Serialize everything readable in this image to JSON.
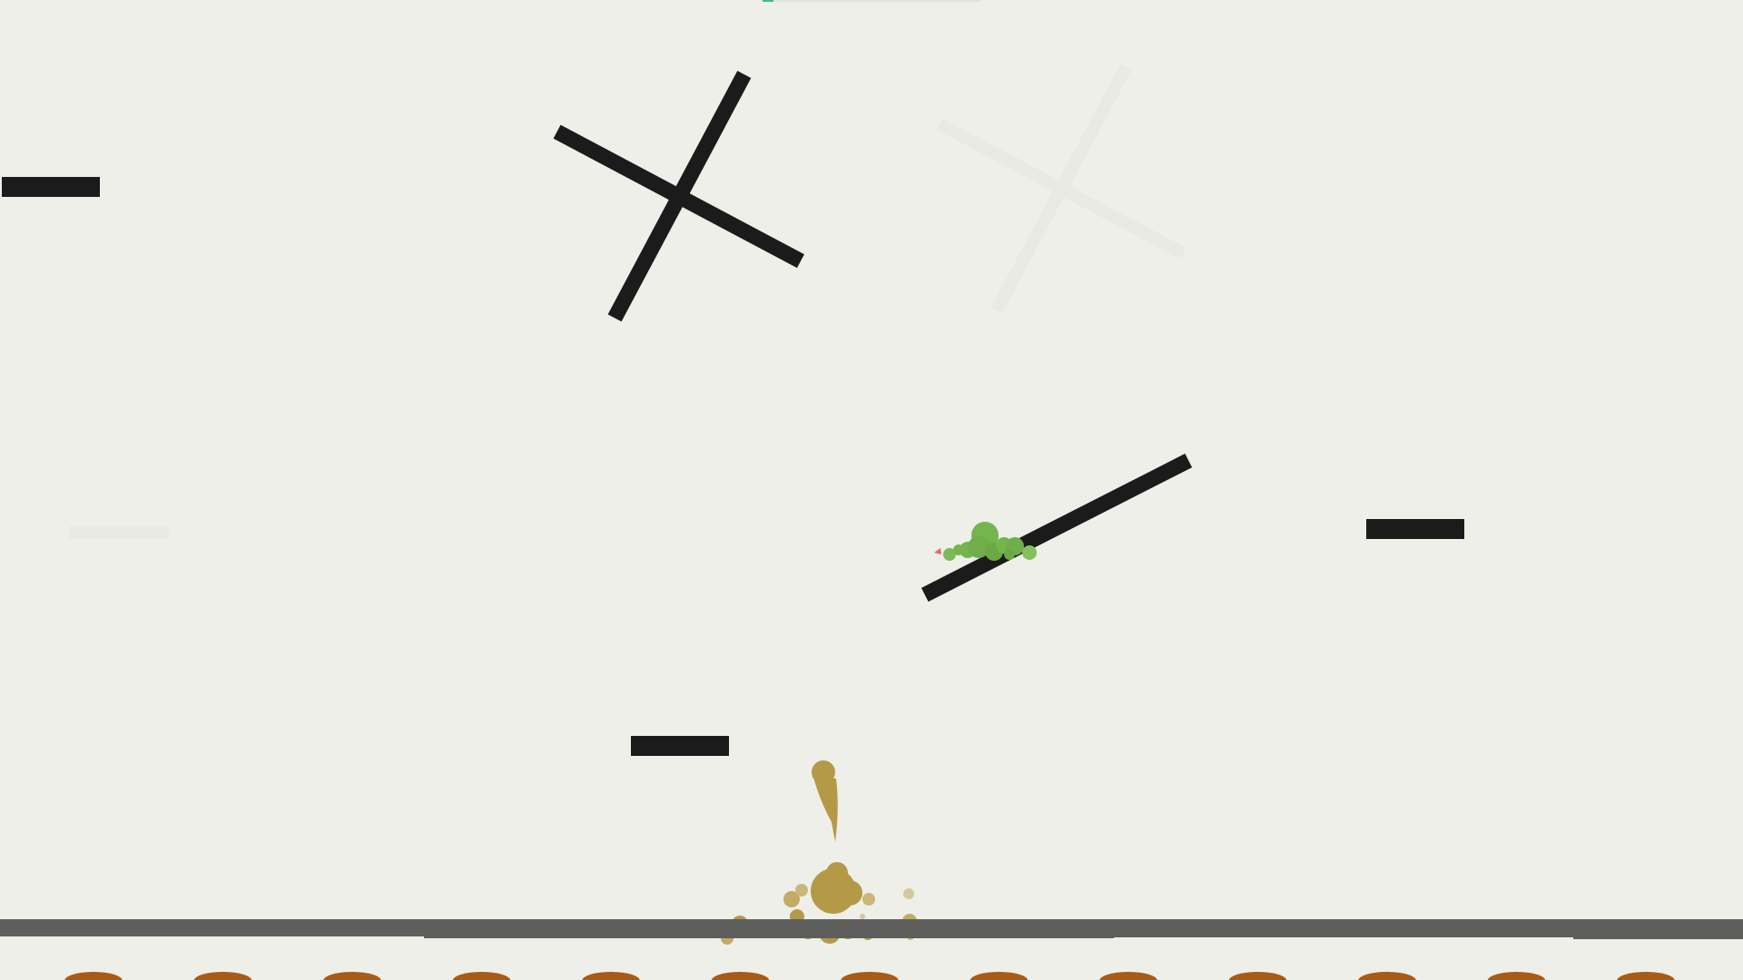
{
  "game": {
    "title": "",
    "colors": {
      "background": "#eeefe9",
      "platform": "#1b1b1b",
      "ghost_platform": "#e8e9e3",
      "ground": "#5e5e5c",
      "player_blob": "#74b54d",
      "player_marker": "#e06b5f",
      "sand_blob": "#b49a47",
      "bumps": "#a85a17",
      "progress": "#3dbf7a"
    },
    "entities": {
      "player": "green-blob",
      "hazard": "sand-blob",
      "spinner": "rotating-cross",
      "ghost_spinner": "faded-rotating-cross",
      "ramp": "tilted-plank"
    },
    "progress": 0.05
  }
}
